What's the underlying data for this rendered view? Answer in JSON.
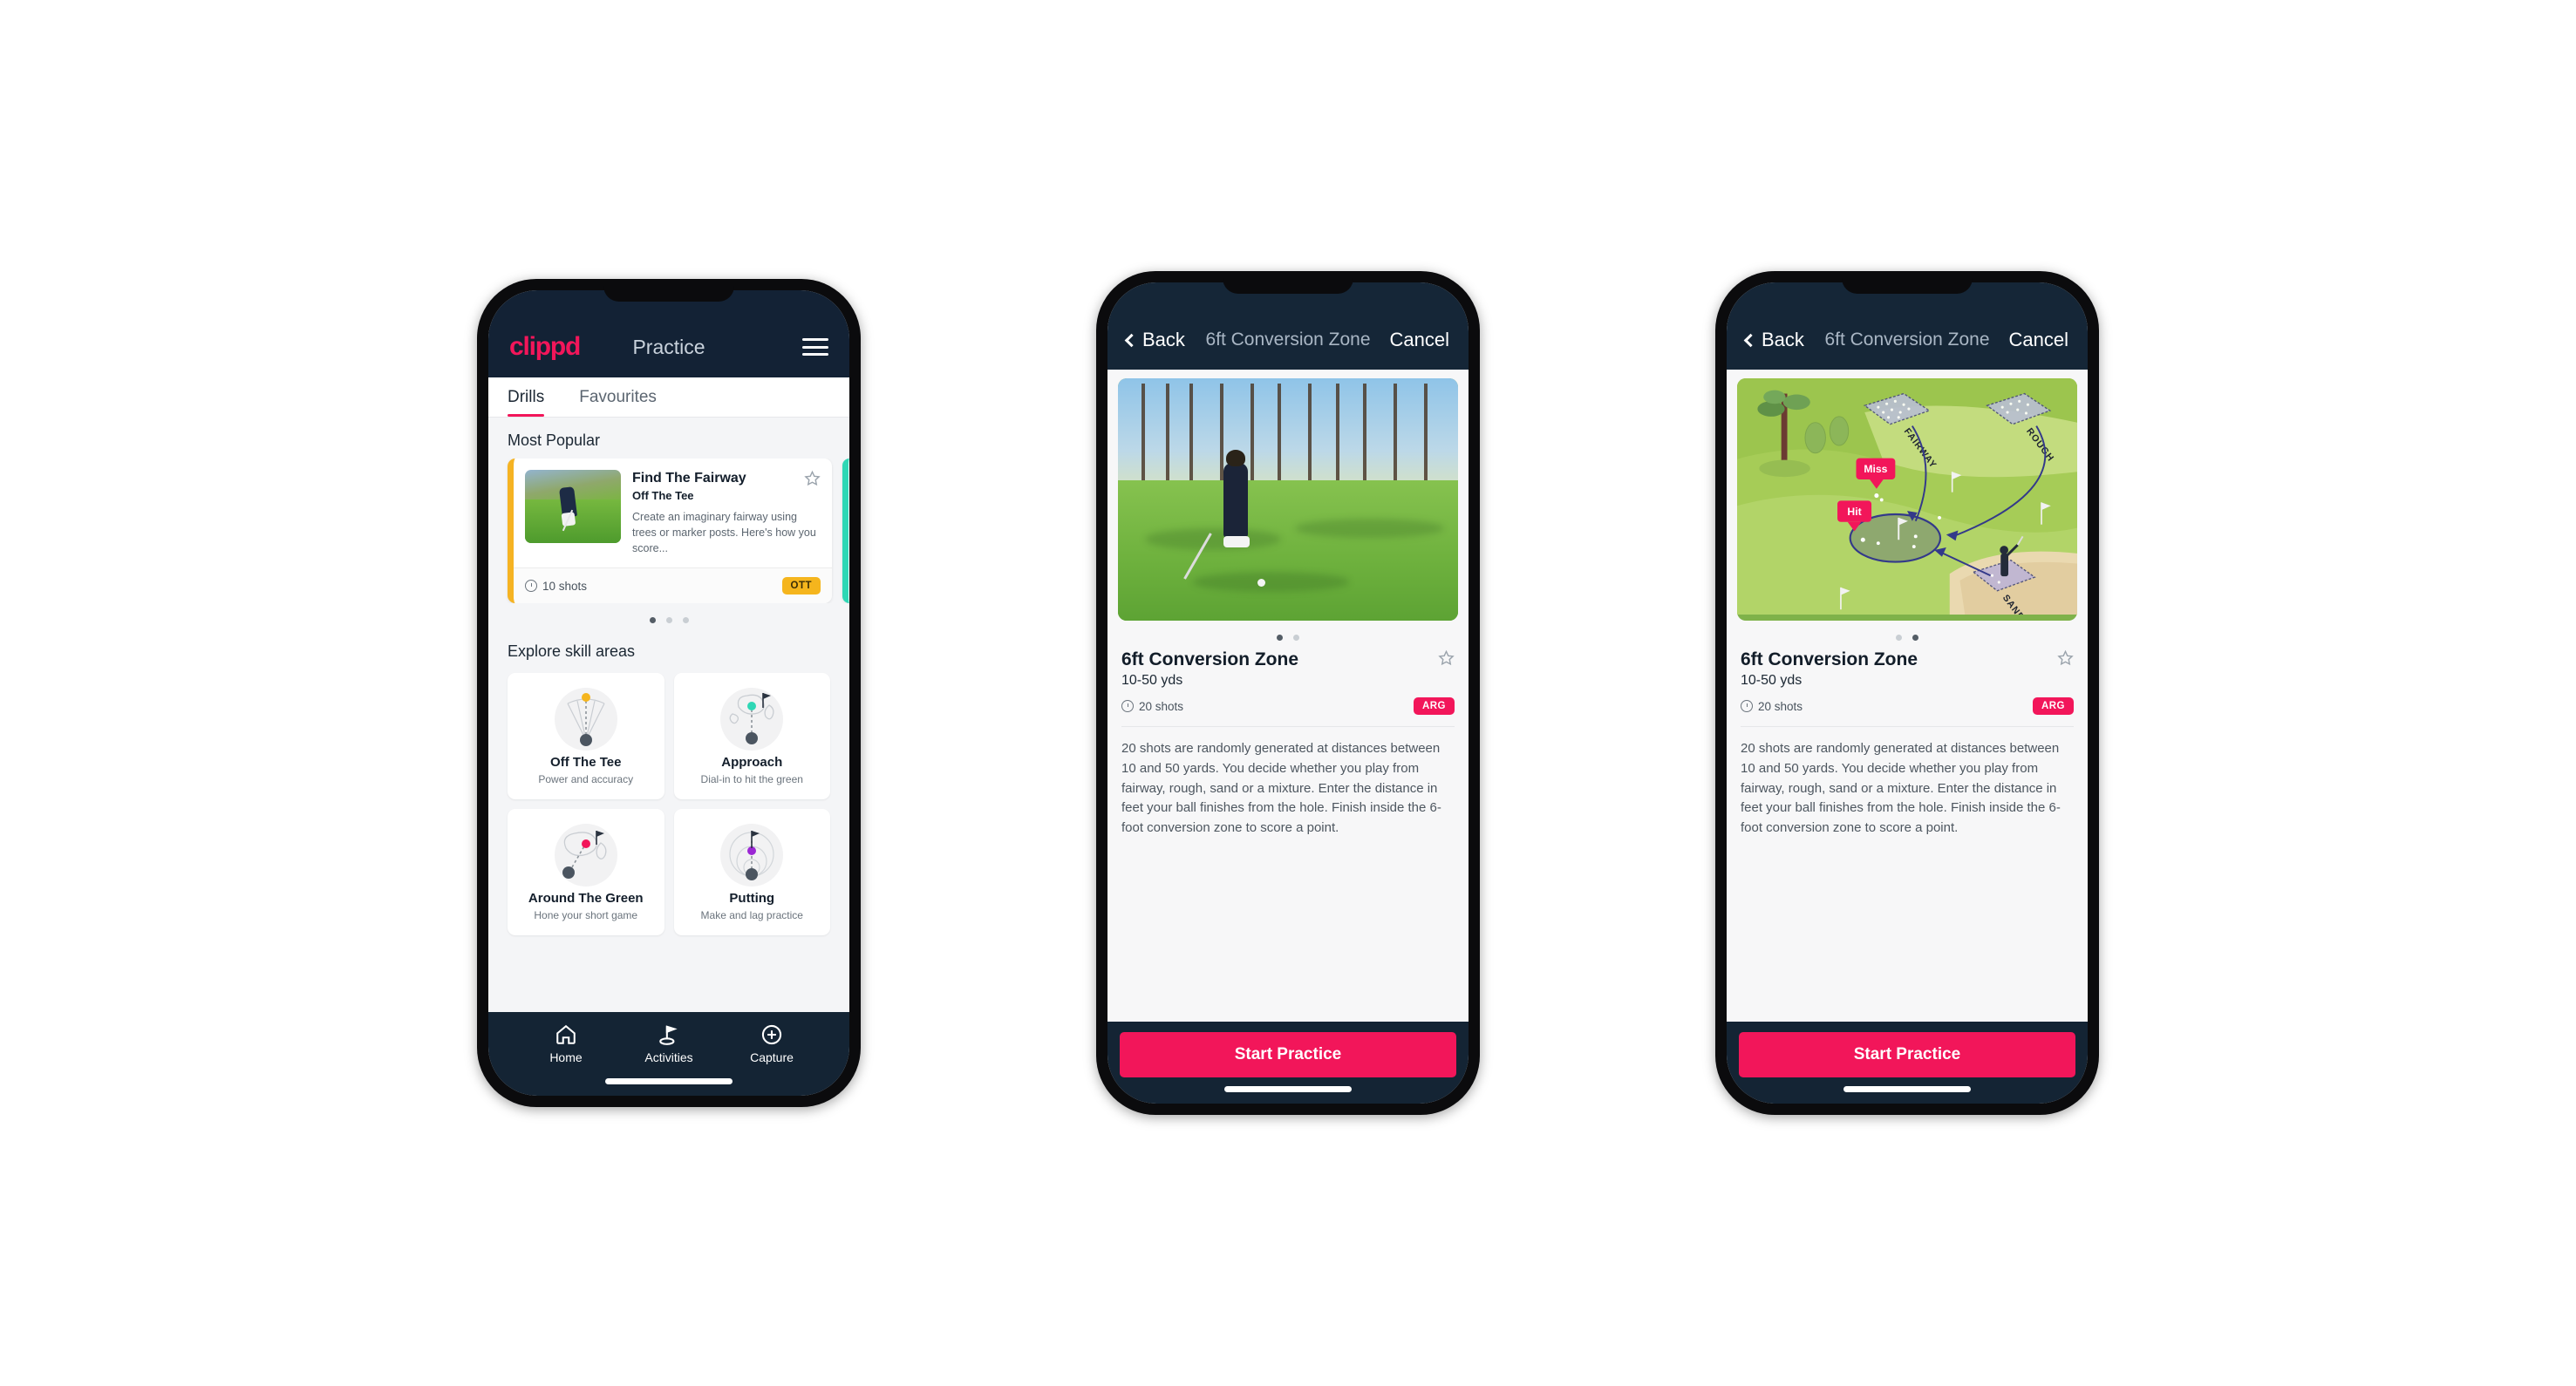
{
  "brand": {
    "logo_text": "clippd",
    "accent_pink": "#f2165a",
    "dark_navy": "#142434",
    "amber": "#f5b51d",
    "teal": "#2fd7b5"
  },
  "phone1": {
    "appbar": {
      "title": "Practice",
      "menu_icon": "hamburger-icon"
    },
    "tabs": [
      {
        "label": "Drills",
        "active": true
      },
      {
        "label": "Favourites",
        "active": false
      }
    ],
    "most_popular": {
      "section_label": "Most Popular",
      "card": {
        "title": "Find The Fairway",
        "subtitle": "Off The Tee",
        "description": "Create an imaginary fairway using trees or marker posts. Here's how you score...",
        "shots": "10 shots",
        "badge": "OTT",
        "star_icon": "star-outline-icon",
        "accent_color": "#f5b51d"
      },
      "dots": [
        {
          "active": true
        },
        {
          "active": false
        },
        {
          "active": false
        }
      ]
    },
    "explore": {
      "section_label": "Explore skill areas",
      "cards": [
        {
          "name": "Off The Tee",
          "desc": "Power and accuracy",
          "icon": "tee-fan-icon",
          "dot_color": "#f5b51d"
        },
        {
          "name": "Approach",
          "desc": "Dial-in to hit the green",
          "icon": "approach-green-icon",
          "dot_color": "#2fd7b5"
        },
        {
          "name": "Around The Green",
          "desc": "Hone your short game",
          "icon": "around-green-icon",
          "dot_color": "#f2165a"
        },
        {
          "name": "Putting",
          "desc": "Make and lag practice",
          "icon": "putting-rings-icon",
          "dot_color": "#9b27d4"
        }
      ]
    },
    "bottom_nav": [
      {
        "label": "Home",
        "icon": "home-icon",
        "active": false
      },
      {
        "label": "Activities",
        "icon": "golf-flag-icon",
        "active": true
      },
      {
        "label": "Capture",
        "icon": "plus-circle-icon",
        "active": false
      }
    ]
  },
  "phone2": {
    "navbar": {
      "back_label": "Back",
      "title": "6ft Conversion Zone",
      "cancel_label": "Cancel",
      "back_icon": "chevron-left-icon"
    },
    "media": {
      "type": "photo",
      "alt": "golfer-chipping-photo"
    },
    "dots": [
      {
        "active": true
      },
      {
        "active": false
      }
    ],
    "title": "6ft Conversion Zone",
    "subtitle": "10-50 yds",
    "shots": "20 shots",
    "badge": "ARG",
    "star_icon": "star-outline-icon",
    "description": "20 shots are randomly generated at distances between 10 and 50 yards. You decide whether you play from fairway, rough, sand or a mixture. Enter the distance in feet your ball finishes from the hole. Finish inside the 6-foot conversion zone to score a point.",
    "cta_label": "Start Practice"
  },
  "phone3": {
    "navbar": {
      "back_label": "Back",
      "title": "6ft Conversion Zone",
      "cancel_label": "Cancel",
      "back_icon": "chevron-left-icon"
    },
    "media": {
      "type": "illustration",
      "labels": {
        "fairway": "FAIRWAY",
        "rough": "ROUGH",
        "sand": "SAND",
        "miss": "Miss",
        "hit": "Hit"
      }
    },
    "dots": [
      {
        "active": false
      },
      {
        "active": true
      }
    ],
    "title": "6ft Conversion Zone",
    "subtitle": "10-50 yds",
    "shots": "20 shots",
    "badge": "ARG",
    "star_icon": "star-outline-icon",
    "description": "20 shots are randomly generated at distances between 10 and 50 yards. You decide whether you play from fairway, rough, sand or a mixture. Enter the distance in feet your ball finishes from the hole. Finish inside the 6-foot conversion zone to score a point.",
    "cta_label": "Start Practice"
  }
}
